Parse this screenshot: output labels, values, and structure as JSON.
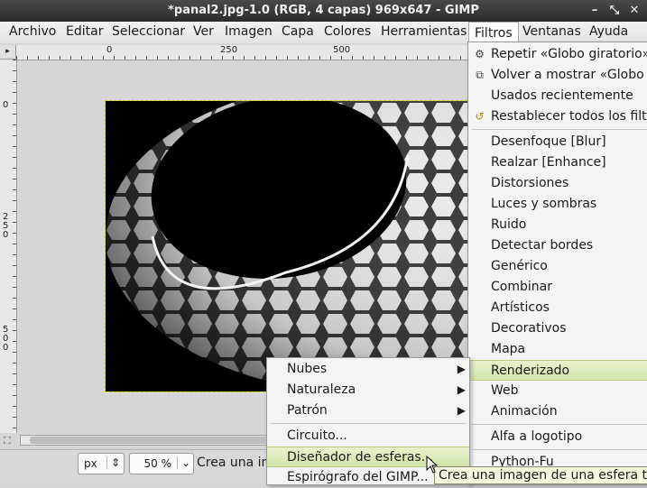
{
  "window": {
    "title": "*panal2.jpg-1.0 (RGB, 4 capas) 969x647 - GIMP",
    "controls": [
      "–",
      "⤡",
      "✕"
    ]
  },
  "menubar": {
    "items": [
      "Archivo",
      "Editar",
      "Seleccionar",
      "Ver",
      "Imagen",
      "Capa",
      "Colores",
      "Herramientas",
      "Filtros",
      "Ventanas",
      "Ayuda"
    ],
    "active": "Filtros"
  },
  "rulers": {
    "top_labels": [
      "0",
      "250",
      "500"
    ],
    "left_labels": [
      "0",
      "250",
      "500"
    ]
  },
  "filters_menu": {
    "items": [
      {
        "label": "Repetir «Globo giratorio»",
        "icon": "repeat-icon"
      },
      {
        "label": "Volver a mostrar «Globo gi",
        "icon": "reshow-icon"
      },
      {
        "label": "Usados recientemente"
      },
      {
        "label": "Restablecer todos los filtro",
        "icon": "reset-icon"
      },
      {
        "label": "Desenfoque [Blur]"
      },
      {
        "label": "Realzar [Enhance]"
      },
      {
        "label": "Distorsiones"
      },
      {
        "label": "Luces y sombras"
      },
      {
        "label": "Ruido"
      },
      {
        "label": "Detectar bordes"
      },
      {
        "label": "Genérico"
      },
      {
        "label": "Combinar"
      },
      {
        "label": "Artísticos"
      },
      {
        "label": "Decorativos"
      },
      {
        "label": "Mapa"
      },
      {
        "label": "Renderizado"
      },
      {
        "label": "Web"
      },
      {
        "label": "Animación"
      },
      {
        "label": "Alfa a logotipo"
      },
      {
        "label": "Python-Fu"
      }
    ],
    "highlighted": "Renderizado"
  },
  "render_submenu": {
    "items": [
      {
        "label": "Nubes",
        "has_submenu": true
      },
      {
        "label": "Naturaleza",
        "has_submenu": true
      },
      {
        "label": "Patrón",
        "has_submenu": true
      },
      {
        "label": "Circuito..."
      },
      {
        "label": "Diseñador de esferas..."
      },
      {
        "label": "Espirógrafo del GIMP..."
      }
    ],
    "highlighted": "Diseñador de esferas..."
  },
  "statusbar": {
    "unit": "px",
    "zoom": "50 %",
    "message": "Crea una im"
  },
  "tooltip": "Crea una imagen de una esfera text",
  "colors": {
    "highlight": "#d3e4a8",
    "selection_border": "#d4d400",
    "title_bar": "#2b2b2b"
  }
}
